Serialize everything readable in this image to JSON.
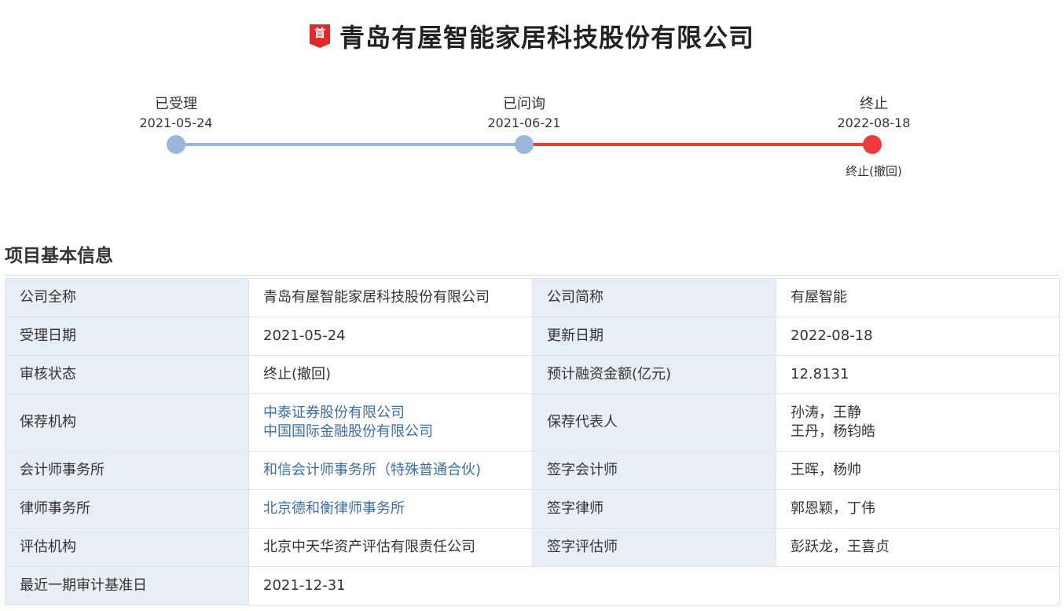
{
  "header": {
    "badge": "首",
    "title": "青岛有屋智能家居科技股份有限公司"
  },
  "timeline": {
    "steps": [
      {
        "label": "已受理",
        "date": "2021-05-24"
      },
      {
        "label": "已问询",
        "date": "2021-06-21"
      },
      {
        "label": "终止",
        "date": "2022-08-18",
        "sub": "终止(撤回)"
      }
    ],
    "colors": {
      "done": "#9cb6d9",
      "terminated": "#f03a3a"
    }
  },
  "section": {
    "title": "项目基本信息"
  },
  "info": {
    "company_full_name": {
      "label": "公司全称",
      "value": "青岛有屋智能家居科技股份有限公司"
    },
    "company_short_name": {
      "label": "公司简称",
      "value": "有屋智能"
    },
    "accept_date": {
      "label": "受理日期",
      "value": "2021-05-24"
    },
    "update_date": {
      "label": "更新日期",
      "value": "2022-08-18"
    },
    "review_status": {
      "label": "审核状态",
      "value": "终止(撤回)"
    },
    "planned_financing": {
      "label": "预计融资金额(亿元)",
      "value": "12.8131"
    },
    "sponsor": {
      "label": "保荐机构",
      "values": [
        "中泰证券股份有限公司",
        "中国国际金融股份有限公司"
      ]
    },
    "sponsor_reps": {
      "label": "保荐代表人",
      "values": [
        "孙涛，王静",
        "王丹，杨钧皓"
      ]
    },
    "accounting_firm": {
      "label": "会计师事务所",
      "value": "和信会计师事务所（特殊普通合伙)"
    },
    "signing_accountant": {
      "label": "签字会计师",
      "value": "王晖，杨帅"
    },
    "law_firm": {
      "label": "律师事务所",
      "value": "北京德和衡律师事务所"
    },
    "signing_lawyer": {
      "label": "签字律师",
      "value": "郭恩颖，丁伟"
    },
    "appraisal_firm": {
      "label": "评估机构",
      "value": "北京中天华资产评估有限责任公司"
    },
    "signing_appraiser": {
      "label": "签字评估师",
      "value": "彭跃龙，王喜贞"
    },
    "audit_base_date": {
      "label": "最近一期审计基准日",
      "value": "2021-12-31"
    }
  }
}
